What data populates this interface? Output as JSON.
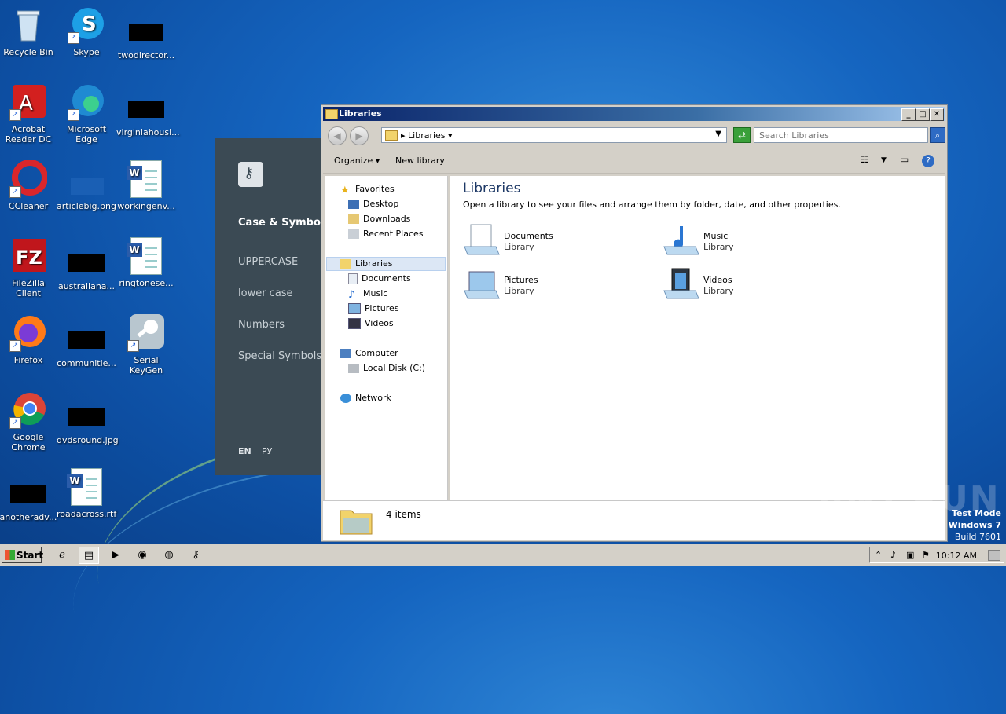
{
  "desktop": {
    "icons": [
      {
        "label": "Recycle Bin",
        "icon": "recycle-bin-icon"
      },
      {
        "label": "Skype",
        "icon": "skype-icon"
      },
      {
        "label": "twodirector...",
        "icon": "redacted-file-icon"
      },
      {
        "label": "Acrobat Reader DC",
        "icon": "acrobat-icon"
      },
      {
        "label": "Microsoft Edge",
        "icon": "edge-icon"
      },
      {
        "label": "virginiahousi...",
        "icon": "redacted-file-icon"
      },
      {
        "label": "CCleaner",
        "icon": "ccleaner-icon"
      },
      {
        "label": "articlebig.png",
        "icon": "image-file-icon"
      },
      {
        "label": "workingenv...",
        "icon": "word-doc-icon"
      },
      {
        "label": "FileZilla Client",
        "icon": "filezilla-icon"
      },
      {
        "label": "australiana...",
        "icon": "redacted-file-icon"
      },
      {
        "label": "ringtonese...",
        "icon": "word-doc-icon"
      },
      {
        "label": "Firefox",
        "icon": "firefox-icon"
      },
      {
        "label": "communitie...",
        "icon": "redacted-file-icon"
      },
      {
        "label": "Serial KeyGen",
        "icon": "key-icon"
      },
      {
        "label": "Google Chrome",
        "icon": "chrome-icon"
      },
      {
        "label": "dvdsround.jpg",
        "icon": "redacted-file-icon"
      },
      {
        "label": "anotheradv...",
        "icon": "redacted-file-icon"
      },
      {
        "label": "roadacross.rtf",
        "icon": "word-doc-icon"
      }
    ]
  },
  "panel": {
    "title": "Case & Symbols",
    "items": [
      "UPPERCASE",
      "lower case",
      "Numbers",
      "Special Symbols"
    ],
    "lang_en": "EN",
    "lang_ru": "РУ"
  },
  "explorer": {
    "title": "Libraries",
    "address": "Libraries",
    "search_placeholder": "Search Libraries",
    "toolbar": {
      "organize": "Organize",
      "new_library": "New library"
    },
    "nav": {
      "favorites": "Favorites",
      "desktop": "Desktop",
      "downloads": "Downloads",
      "recent": "Recent Places",
      "libraries": "Libraries",
      "documents": "Documents",
      "music": "Music",
      "pictures": "Pictures",
      "videos": "Videos",
      "computer": "Computer",
      "local_disk": "Local Disk (C:)",
      "network": "Network"
    },
    "heading": "Libraries",
    "subheading": "Open a library to see your files and arrange them by folder, date, and other properties.",
    "libraries": [
      {
        "name": "Documents",
        "type": "Library"
      },
      {
        "name": "Music",
        "type": "Library"
      },
      {
        "name": "Pictures",
        "type": "Library"
      },
      {
        "name": "Videos",
        "type": "Library"
      }
    ],
    "item_count": "4 items"
  },
  "watermark": "ANY.RUN",
  "test_mode": {
    "line1": "Test Mode",
    "line2": "Windows 7",
    "line3": "Build 7601"
  },
  "taskbar": {
    "start": "Start",
    "clock": "10:12 AM"
  }
}
